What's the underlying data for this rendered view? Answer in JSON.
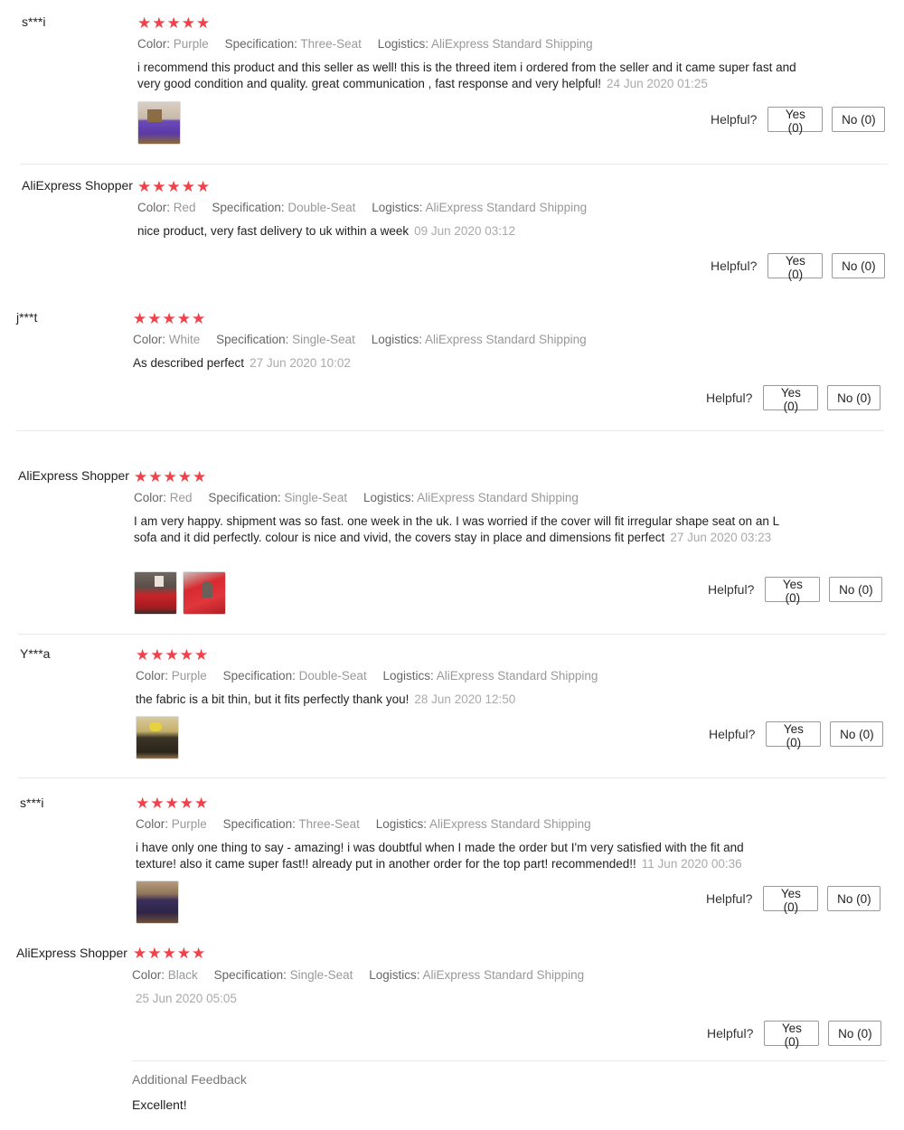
{
  "helpful_label": "Helpful?",
  "yes_label": "Yes (0)",
  "no_label": "No (0)",
  "labels": {
    "color": "Color:",
    "specification": "Specification:",
    "logistics": "Logistics:"
  },
  "star_color": "#f0424a",
  "stars_glyph": "★★★★★",
  "reviews": [
    {
      "user": "s***i",
      "rating": 5,
      "color": "Purple",
      "specification": "Three-Seat",
      "logistics": "AliExpress Standard Shipping",
      "text": "i recommend this product and this seller as well! this is the threed item i ordered from the seller and it came super fast and very good condition and quality. great communication , fast response and very helpful!",
      "date": "24 Jun 2020 01:25",
      "photos": [
        "purple-sofa-photo"
      ]
    },
    {
      "user": "AliExpress Shopper",
      "rating": 5,
      "color": "Red",
      "specification": "Double-Seat",
      "logistics": "AliExpress Standard Shipping",
      "text": "nice product, very fast delivery to uk within a week",
      "date": "09 Jun 2020 03:12",
      "photos": []
    },
    {
      "user": "j***t",
      "rating": 5,
      "color": "White",
      "specification": "Single-Seat",
      "logistics": "AliExpress Standard Shipping",
      "text": "As described perfect",
      "date": "27 Jun 2020 10:02",
      "photos": []
    },
    {
      "user": "AliExpress Shopper",
      "rating": 5,
      "color": "Red",
      "specification": "Single-Seat",
      "logistics": "AliExpress Standard Shipping",
      "text": "I am very happy. shipment was so fast. one week in the uk. I was worried if the cover will fit irregular shape seat on an L sofa and it did perfectly. colour is nice and vivid, the covers stay in place and dimensions fit perfect",
      "date": "27 Jun 2020 03:23",
      "photos": [
        "red-sofa-photo-1",
        "red-sofa-photo-2"
      ]
    },
    {
      "user": "Y***a",
      "rating": 5,
      "color": "Purple",
      "specification": "Double-Seat",
      "logistics": "AliExpress Standard Shipping",
      "text": "the fabric is a bit thin, but it fits perfectly thank you!",
      "date": "28 Jun 2020 12:50",
      "photos": [
        "dark-sofa-photo"
      ]
    },
    {
      "user": "s***i",
      "rating": 5,
      "color": "Purple",
      "specification": "Three-Seat",
      "logistics": "AliExpress Standard Shipping",
      "text": "i have only one thing to say - amazing! i was doubtful when I made the order but I'm very satisfied with the fit and texture! also it came super fast!! already put in another order for the top part! recommended!!",
      "date": "11 Jun 2020 00:36",
      "photos": [
        "purple-couch-photo"
      ]
    },
    {
      "user": "AliExpress Shopper",
      "rating": 5,
      "color": "Black",
      "specification": "Single-Seat",
      "logistics": "AliExpress Standard Shipping",
      "text": "",
      "date": "25 Jun 2020 05:05",
      "photos": [],
      "additional_feedback_title": "Additional Feedback",
      "additional_feedback_text": "Excellent!"
    }
  ]
}
